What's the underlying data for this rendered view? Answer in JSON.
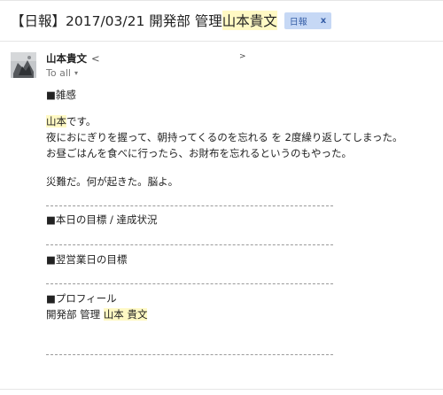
{
  "subject": {
    "prefix": "【日報】2017/03/21 開発部 管理 ",
    "name_highlight": "山本貴文",
    "label": "日報",
    "label_remove": "x"
  },
  "sender": {
    "name": "山本貴文",
    "lt": "<",
    "expand": ">",
    "to_label": "To all",
    "to_caret": "▾"
  },
  "body": {
    "section_misc": "■雑感",
    "greeting_name": "山本",
    "greeting_rest": "です。",
    "line_1": "夜におにぎりを握って、朝持ってくるのを忘れる を 2度繰り返してしまった。",
    "line_2": "お昼ごはんを食べに行ったら、お財布を忘れるというのもやった。",
    "line_3": "災難だ。何が起きた。脳よ。",
    "section_goals": "■本日の目標 / 達成状況",
    "section_next": "■翌営業日の目標",
    "section_profile": "■プロフィール",
    "profile_prefix": "開発部 管理 ",
    "profile_name": "山本 貴文"
  }
}
